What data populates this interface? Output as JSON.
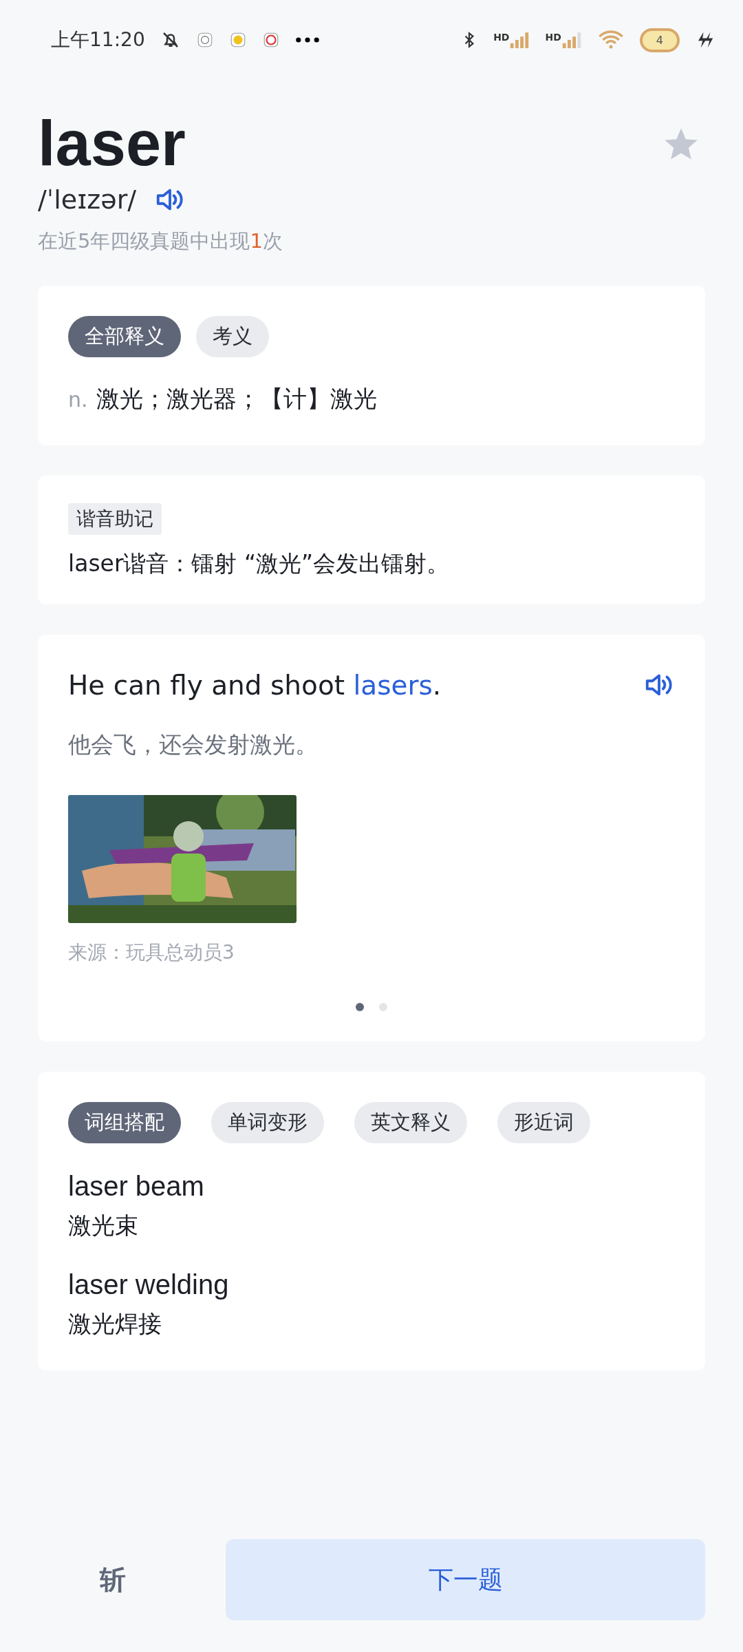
{
  "status_bar": {
    "time": "上午11:20",
    "signal_labels": [
      "HD",
      "HD"
    ],
    "battery": "4"
  },
  "word": {
    "headword": "laser",
    "starred": false,
    "phonetic": "/ˈleɪzər/",
    "frequency": {
      "before": "在近5年四级真题中出现",
      "count": "1",
      "after": "次"
    }
  },
  "definition_card": {
    "tabs": [
      {
        "label": "全部释义",
        "selected": true
      },
      {
        "label": "考义",
        "selected": false
      }
    ],
    "definitions": [
      {
        "pos": "n.",
        "meaning": "激光；激光器；【计】激光"
      }
    ]
  },
  "mnemonic_card": {
    "tag": "谐音助记",
    "text": "laser谐音：镭射 “激光”会发出镭射。"
  },
  "example_card": {
    "sentence": {
      "before": "He can fly and shoot ",
      "highlight": "lasers",
      "after": "."
    },
    "translation": "他会飞，还会发射激光。",
    "source": "来源：玩具总动员3",
    "pager": [
      {
        "selected": true
      },
      {
        "selected": false
      }
    ]
  },
  "phrases_card": {
    "tabs": [
      {
        "label": "词组搭配",
        "selected": true
      },
      {
        "label": "单词变形",
        "selected": false
      },
      {
        "label": "英文释义",
        "selected": false
      },
      {
        "label": "形近词",
        "selected": false
      }
    ],
    "phrases": [
      {
        "phrase": "laser beam",
        "meaning": "激光束"
      },
      {
        "phrase": "laser welding",
        "meaning": "激光焊接"
      }
    ]
  },
  "bottom_bar": {
    "skip": "斩",
    "next": "下一题"
  }
}
